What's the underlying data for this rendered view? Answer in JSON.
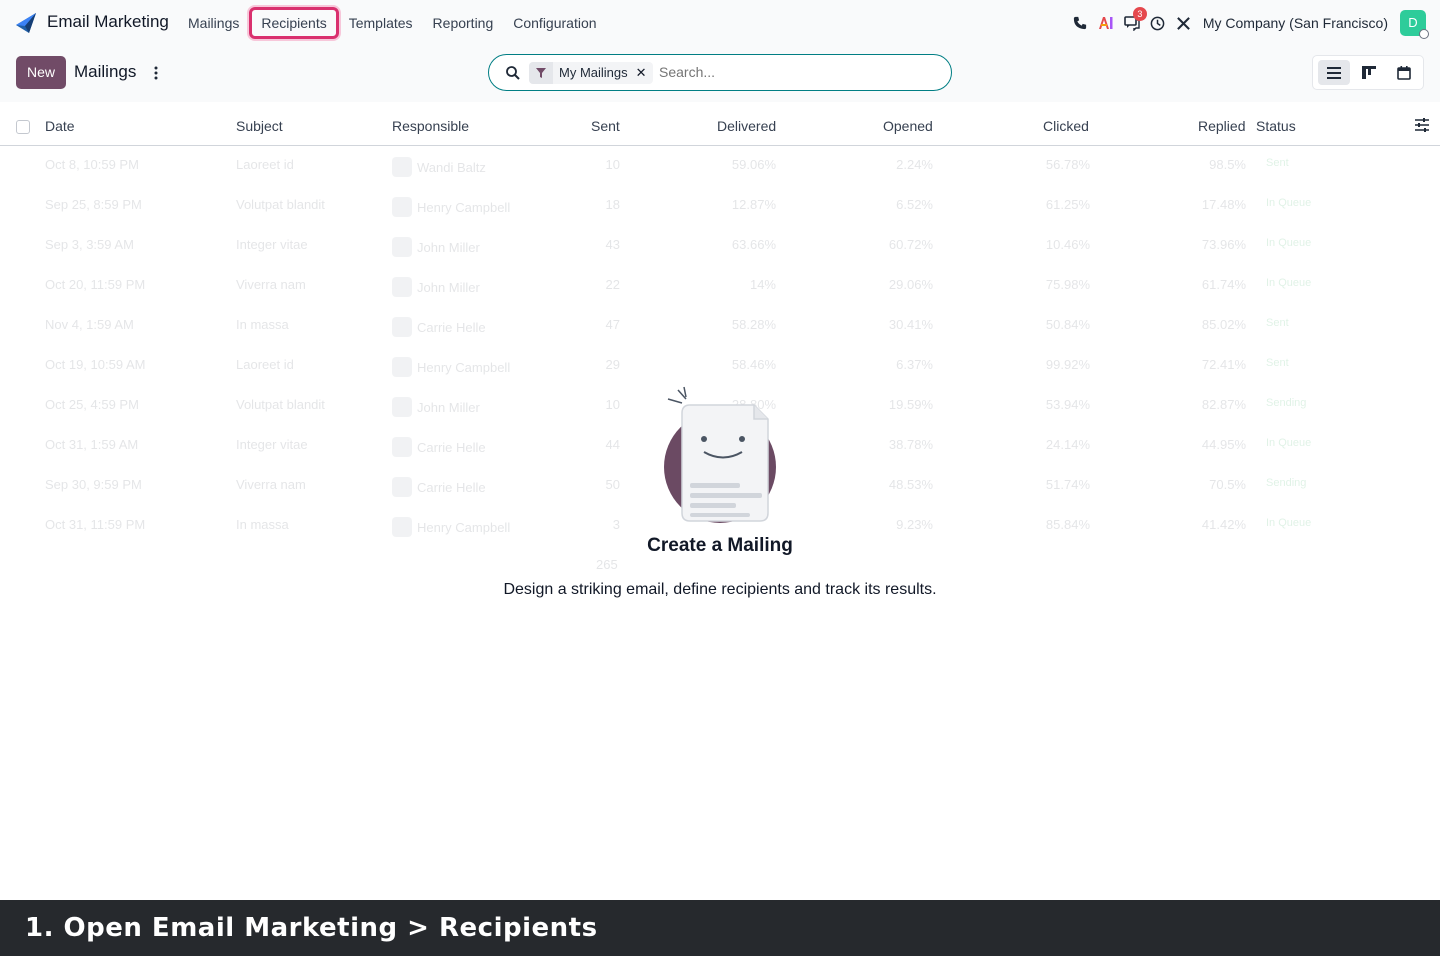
{
  "app": {
    "title": "Email Marketing"
  },
  "menu": [
    {
      "label": "Mailings"
    },
    {
      "label": "Recipients"
    },
    {
      "label": "Templates"
    },
    {
      "label": "Reporting"
    },
    {
      "label": "Configuration"
    }
  ],
  "systray": {
    "icons": [
      "phone-icon",
      "ai-icon",
      "chat-icon",
      "clock-icon",
      "tools-icon"
    ],
    "chat_badge": "3",
    "company": "My Company (San Francisco)",
    "avatar_initial": "D"
  },
  "control": {
    "new_label": "New",
    "breadcrumb": "Mailings",
    "search": {
      "facet": "My Mailings",
      "placeholder": "Search..."
    },
    "views": [
      "list-view-icon",
      "kanban-view-icon",
      "calendar-view-icon"
    ]
  },
  "table": {
    "columns": [
      "Date",
      "Subject",
      "Responsible",
      "Sent",
      "Delivered",
      "Opened",
      "Clicked",
      "Replied",
      "Status"
    ],
    "rows": [
      {
        "date": "Oct 8, 10:59 PM",
        "subject": "Laoreet id",
        "responsible": "Wandi Baltz",
        "sent": "10",
        "delivered": "59.06%",
        "opened": "2.24%",
        "clicked": "56.78%",
        "replied": "98.5%",
        "status": "Sent"
      },
      {
        "date": "Sep 25, 8:59 PM",
        "subject": "Volutpat blandit",
        "responsible": "Henry Campbell",
        "sent": "18",
        "delivered": "12.87%",
        "opened": "6.52%",
        "clicked": "61.25%",
        "replied": "17.48%",
        "status": "In Queue"
      },
      {
        "date": "Sep 3, 3:59 AM",
        "subject": "Integer vitae",
        "responsible": "John Miller",
        "sent": "43",
        "delivered": "63.66%",
        "opened": "60.72%",
        "clicked": "10.46%",
        "replied": "73.96%",
        "status": "In Queue"
      },
      {
        "date": "Oct 20, 11:59 PM",
        "subject": "Viverra nam",
        "responsible": "John Miller",
        "sent": "22",
        "delivered": "14%",
        "opened": "29.06%",
        "clicked": "75.98%",
        "replied": "61.74%",
        "status": "In Queue"
      },
      {
        "date": "Nov 4, 1:59 AM",
        "subject": "In massa",
        "responsible": "Carrie Helle",
        "sent": "47",
        "delivered": "58.28%",
        "opened": "30.41%",
        "clicked": "50.84%",
        "replied": "85.02%",
        "status": "Sent"
      },
      {
        "date": "Oct 19, 10:59 AM",
        "subject": "Laoreet id",
        "responsible": "Henry Campbell",
        "sent": "29",
        "delivered": "58.46%",
        "opened": "6.37%",
        "clicked": "99.92%",
        "replied": "72.41%",
        "status": "Sent"
      },
      {
        "date": "Oct 25, 4:59 PM",
        "subject": "Volutpat blandit",
        "responsible": "John Miller",
        "sent": "10",
        "delivered": "28.80%",
        "opened": "19.59%",
        "clicked": "53.94%",
        "replied": "82.87%",
        "status": "Sending"
      },
      {
        "date": "Oct 31, 1:59 AM",
        "subject": "Integer vitae",
        "responsible": "Carrie Helle",
        "sent": "44",
        "delivered": "",
        "opened": "38.78%",
        "clicked": "24.14%",
        "replied": "44.95%",
        "status": "In Queue"
      },
      {
        "date": "Sep 30, 9:59 PM",
        "subject": "Viverra nam",
        "responsible": "Carrie Helle",
        "sent": "50",
        "delivered": "",
        "opened": "48.53%",
        "clicked": "51.74%",
        "replied": "70.5%",
        "status": "Sending"
      },
      {
        "date": "Oct 31, 11:59 PM",
        "subject": "In massa",
        "responsible": "Henry Campbell",
        "sent": "3",
        "delivered": "",
        "opened": "9.23%",
        "clicked": "85.84%",
        "replied": "41.42%",
        "status": "In Queue"
      }
    ],
    "total_sent": "265"
  },
  "empty_state": {
    "title": "Create a Mailing",
    "text": "Design a striking email, define recipients and track its results."
  },
  "caption": "1. Open Email Marketing > Recipients",
  "colors": {
    "brand": "#714b67",
    "highlight": "#d9306e",
    "search_border": "#017e84",
    "footer": "#26292d"
  }
}
